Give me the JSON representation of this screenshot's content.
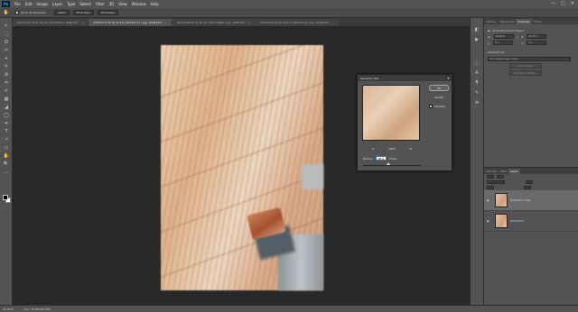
{
  "menubar": {
    "logo": "Ps",
    "items": [
      "File",
      "Edit",
      "Image",
      "Layer",
      "Type",
      "Select",
      "Filter",
      "3D",
      "View",
      "Window",
      "Help"
    ],
    "window_controls": [
      "—",
      "□",
      "✕"
    ]
  },
  "options": {
    "scroll_all_label": "Scroll All Windows",
    "zoom_value": "100%",
    "fit_screen_label": "Fit Screen",
    "fill_screen_label": "Fill Screen"
  },
  "tabs": [
    {
      "label": "DSCF2171.tif @ 16.7% (DSCF2621, RGB/16*)",
      "active": false
    },
    {
      "label": "DSCF2171.tif @ 16.7% (DSCF2171 copy, RGB/16*)",
      "active": true
    },
    {
      "label": "DSCF1689.tif @ 16.7% (DSCF1689 copy, RGB/16*)",
      "active": false
    },
    {
      "label": "DSCF0223.tif @ 16.7% (DSCF0223 copy, RGB/16*)",
      "active": false
    }
  ],
  "tools": [
    "↖",
    "⬚",
    "ʘ",
    "✂",
    "⌖",
    "✎",
    "⊕",
    "♒",
    "✐",
    "▦",
    "◢",
    "◯",
    "✦",
    "T",
    "↗",
    "▭",
    "✋",
    "🔍",
    "…"
  ],
  "dialog": {
    "title": "Gaussian Blur",
    "close": "x",
    "ok_label": "OK",
    "cancel_label": "Cancel",
    "preview_label": "Preview",
    "preview_checked": "✓",
    "zoom_out": "⊖",
    "zoom_value": "100%",
    "zoom_in": "⊕",
    "radius_label": "Radius:",
    "radius_value": "18.4",
    "radius_unit": "Pixels"
  },
  "panels": {
    "tabs": [
      "Libraries",
      "Adjustments",
      "Properties",
      "History"
    ],
    "active_tab": "Properties",
    "object_label": "Embedded Smart Object",
    "w_label": "W:",
    "w_value": "16.88 in",
    "h_label": "H:",
    "h_value": "25.33 in",
    "x_label": "X:",
    "x_value": "0 in",
    "y_label": "Y:",
    "y_value": "0 in",
    "filename": "DSCF2171.tif",
    "layer_comp": "Don't Apply Layer Comp",
    "edit_contents": "Edit Contents",
    "convert_linked": "Convert to Linked..."
  },
  "layers_panel": {
    "tabs": [
      "Channels",
      "Paths",
      "Layers"
    ],
    "active_tab": "Layers",
    "layers": [
      {
        "name": "DSCF2171 copy",
        "selected": true
      },
      {
        "name": "DSCF2171",
        "selected": false
      }
    ]
  },
  "status": {
    "zoom": "16.67%",
    "doc_info": "Doc: 76.9M/153.8M"
  }
}
